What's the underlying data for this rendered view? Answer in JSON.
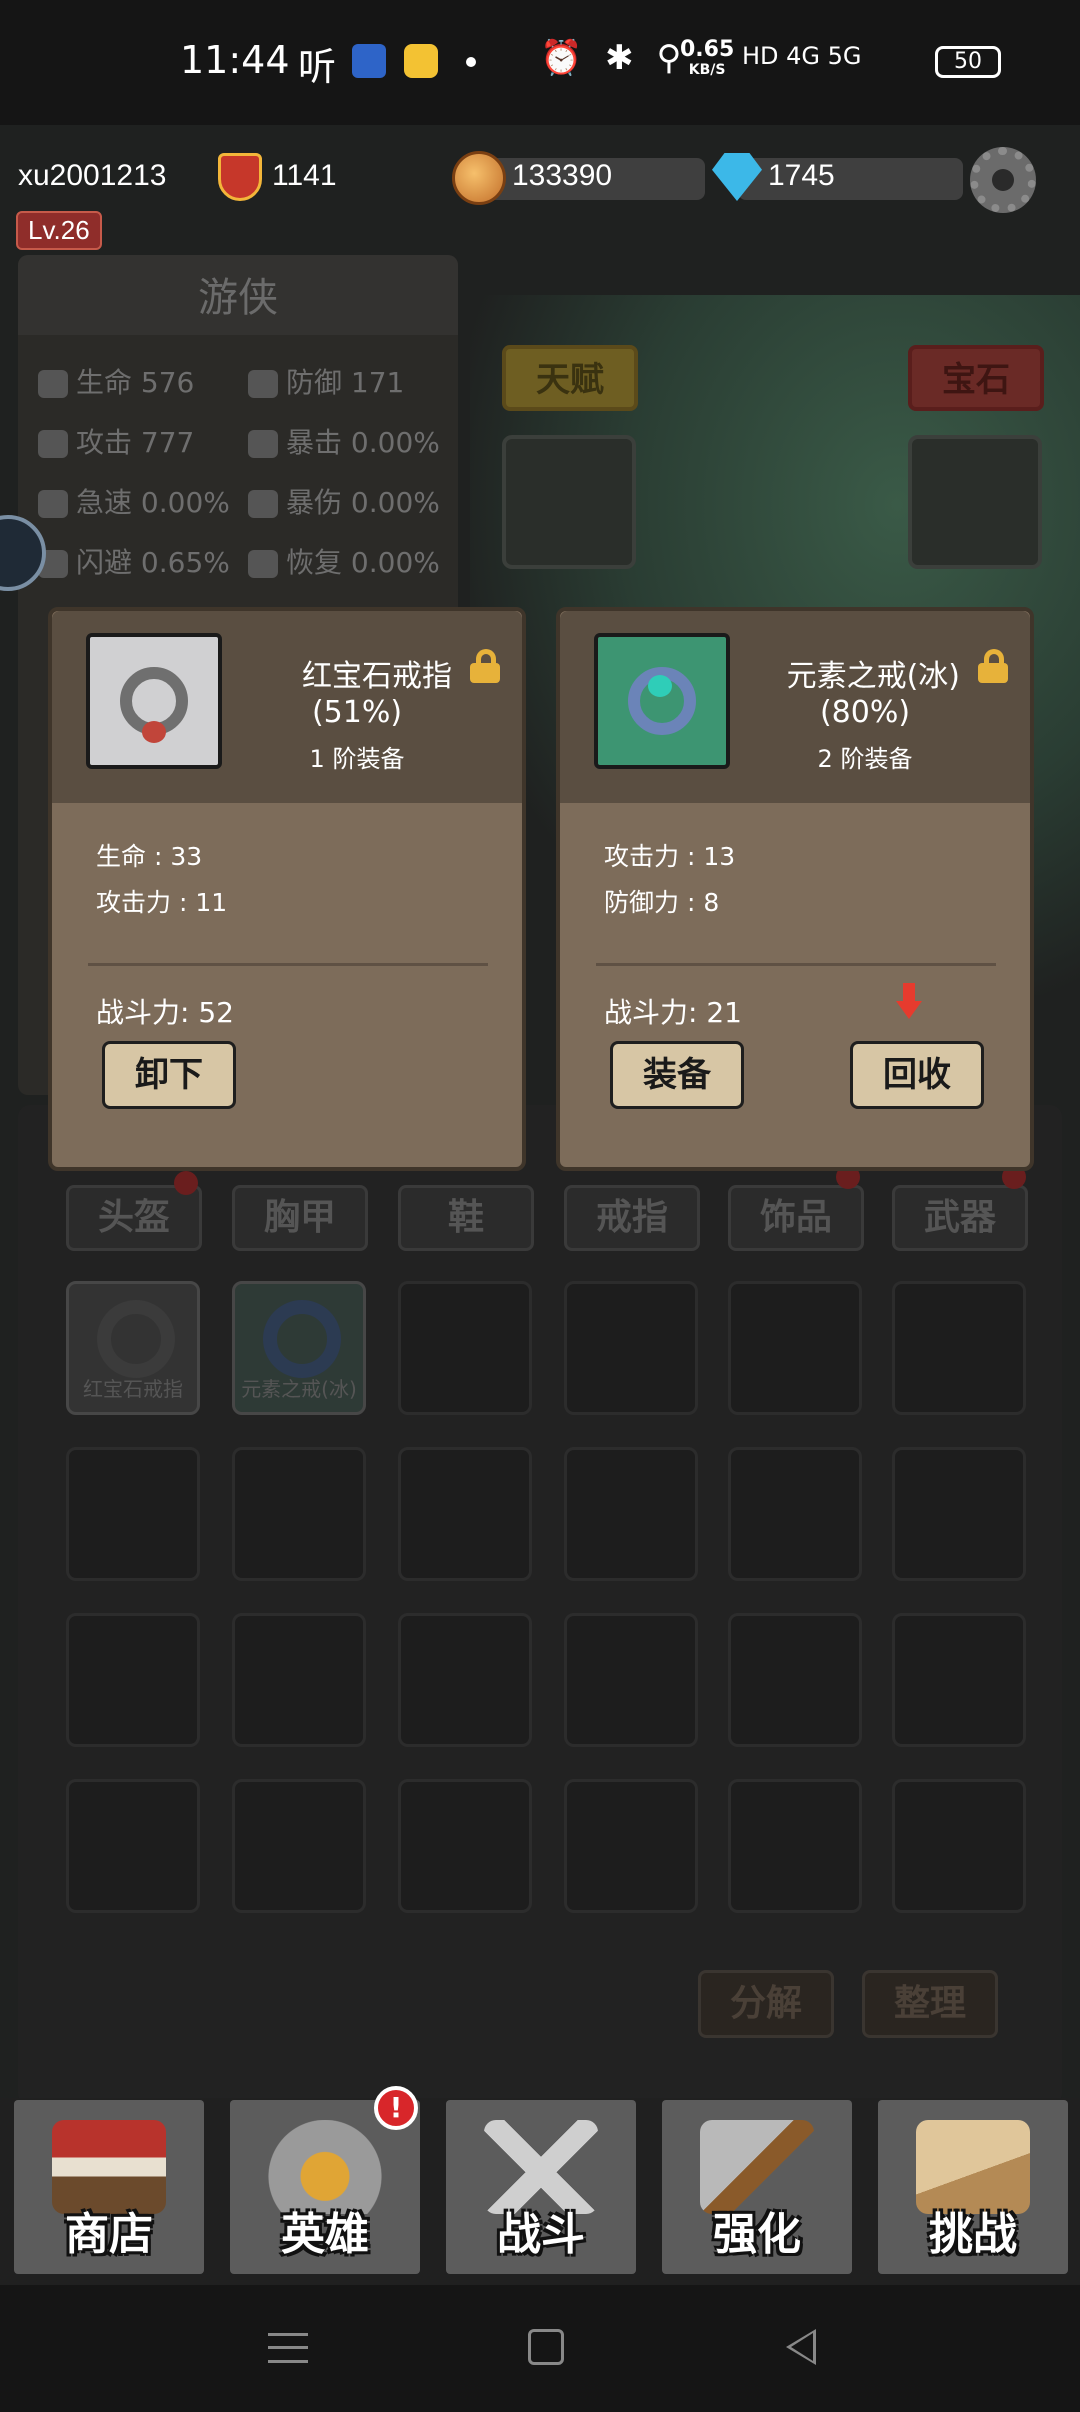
{
  "status_bar": {
    "time": "11:44",
    "ting_label": "听",
    "net_speed_value": "0.65",
    "net_speed_unit": "KB/S",
    "network_label": "HD 4G 5G",
    "battery": "50"
  },
  "player": {
    "username": "xu2001213",
    "combat_power": "1141",
    "level": "Lv.26",
    "coins": "133390",
    "gems": "1745"
  },
  "hero": {
    "class_name": "游侠",
    "stats": [
      {
        "label": "生命",
        "value": "576"
      },
      {
        "label": "防御",
        "value": "171"
      },
      {
        "label": "攻击",
        "value": "777"
      },
      {
        "label": "暴击",
        "value": "0.00%"
      },
      {
        "label": "急速",
        "value": "0.00%"
      },
      {
        "label": "暴伤",
        "value": "0.00%"
      },
      {
        "label": "闪避",
        "value": "0.65%"
      },
      {
        "label": "恢复",
        "value": "0.00%"
      }
    ],
    "talent_label": "天赋",
    "gem_label": "宝石"
  },
  "popup_equipped": {
    "name": "红宝石戒指",
    "quality_pct": "(51%)",
    "tier": "1 阶装备",
    "stat1": "生命 : 33",
    "stat2": "攻击力 : 11",
    "power": "战斗力: 52",
    "unequip_label": "卸下"
  },
  "popup_compare": {
    "name": "元素之戒(冰)",
    "quality_pct": "(80%)",
    "tier": "2 阶装备",
    "stat1": "攻击力 : 13",
    "stat2": "防御力 : 8",
    "power": "战斗力: 21",
    "equip_label": "装备",
    "recycle_label": "回收"
  },
  "categories": [
    "头盔",
    "胸甲",
    "鞋",
    "戒指",
    "饰品",
    "武器"
  ],
  "inventory": {
    "item1_label": "红宝石戒指",
    "item2_label": "元素之戒(冰)",
    "decompose_label": "分解",
    "sort_label": "整理"
  },
  "nav": {
    "shop": "商店",
    "hero": "英雄",
    "hero_badge": "!",
    "battle": "战斗",
    "upgrade": "强化",
    "challenge": "挑战"
  },
  "colors": {
    "popup_bg": "#7d6c5a",
    "popup_head": "#5a4e41",
    "button_bg": "#d7c6a5",
    "accent_gold": "#e7b23a",
    "down_arrow": "#e63b2e"
  }
}
